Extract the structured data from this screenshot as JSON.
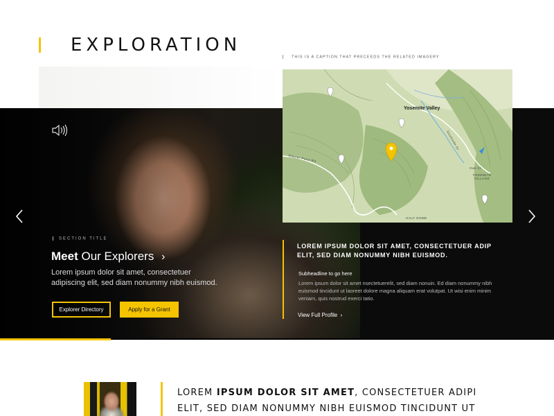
{
  "header": {
    "title": "EXPLORATION"
  },
  "caption": "THIS IS A CAPTION THAT PRECEEDS THE RELATED IMAGERY",
  "map": {
    "place_main": "Yosemite Valley",
    "road_left": "Glacier Point Rd",
    "road_right": "Southside Dr",
    "village": "YOSEMITE VILLAGE",
    "half_dome": "HALF DOME",
    "oak": "Oak Ct"
  },
  "hero": {
    "section_label": "SECTION TITLE",
    "title_bold": "Meet",
    "title_rest": "Our Explorers",
    "body": "Lorem ipsum dolor sit amet, consectetuer adipiscing elit, sed diam nonummy nibh euismod.",
    "btn_directory": "Explorer Directory",
    "btn_grant": "Apply for a Grant",
    "progress": 0.2
  },
  "panel": {
    "headline": "LOREM IPSUM DOLOR SIT AMET, CONSECTETUER ADIP ELIT, SED DIAM NONUMMY NIBH EUISMOD.",
    "subheadline": "Subheadline to go here",
    "body": "Lorem ipsum dolor sit amet nsectetuerelit, sed diam nonuin. Ed diam nonummy nibh euismod tincidunt ut laoreet dolore magna aliquam erat volutpat. Ut wisi enim minim veniam, quis nostrud exerci tatio.",
    "link": "View Full Profile"
  },
  "teaser": {
    "text_a": "LOREM ",
    "text_bold": "IPSUM DOLOR SIT AMET",
    "text_b": ", CONSECTETUER ADIPI ELIT, SED DIAM NONUMMY NIBH EUISMOD TINCIDUNT UT"
  },
  "colors": {
    "accent": "#f5c400",
    "hero_bg": "#0b0b0b"
  }
}
